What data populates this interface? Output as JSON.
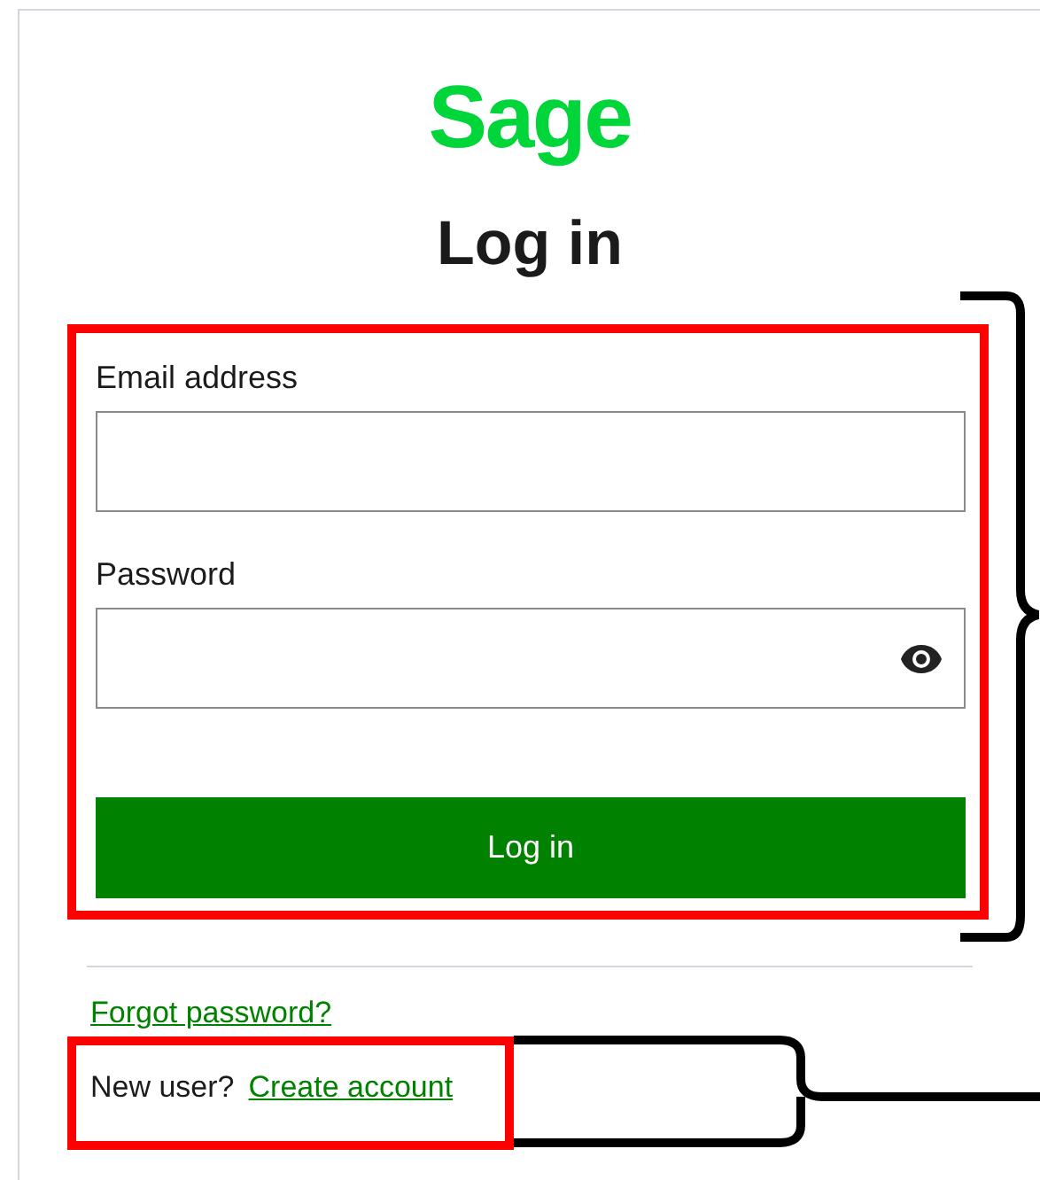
{
  "logo": {
    "text": "Sage"
  },
  "heading": "Log in",
  "fields": [
    {
      "label": "Email address",
      "kind": "text"
    },
    {
      "label": "Password",
      "kind": "password"
    }
  ],
  "submit_button": "Log in",
  "forgot_link": "Forgot password?",
  "signup": {
    "prompt": "New user?",
    "link": "Create account"
  }
}
